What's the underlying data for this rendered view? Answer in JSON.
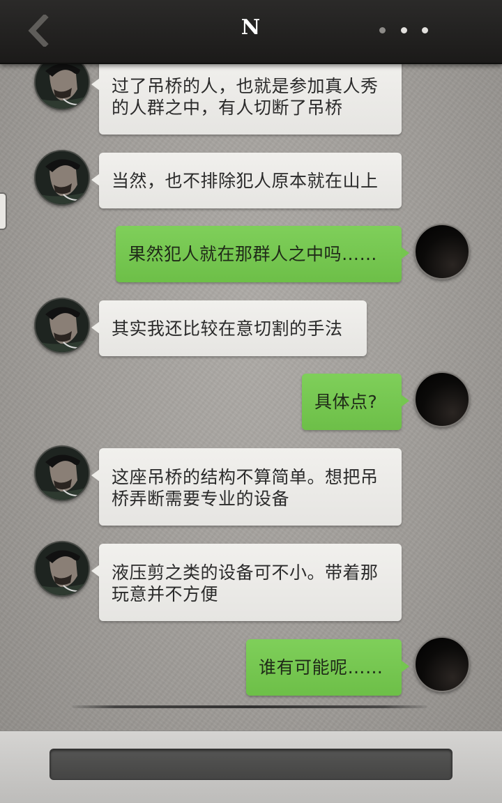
{
  "header": {
    "title": "N"
  },
  "messages": [
    {
      "side": "in",
      "text": "过了吊桥的人，也就是参加真人秀的人群之中，有人切断了吊桥"
    },
    {
      "side": "in",
      "text": "当然，也不排除犯人原本就在山上"
    },
    {
      "side": "out",
      "text": "果然犯人就在那群人之中吗……"
    },
    {
      "side": "in",
      "text": "其实我还比较在意切割的手法"
    },
    {
      "side": "out",
      "text": "具体点?"
    },
    {
      "side": "in",
      "text": "这座吊桥的结构不算简单。想把吊桥弄断需要专业的设备"
    },
    {
      "side": "in",
      "text": "液压剪之类的设备可不小。带着那玩意并不方便"
    },
    {
      "side": "out",
      "text": "谁有可能呢……"
    }
  ],
  "input": {
    "value": ""
  },
  "colors": {
    "incoming_bubble": "#eeede9",
    "outgoing_bubble": "#75c650",
    "top_bar": "#222120"
  }
}
